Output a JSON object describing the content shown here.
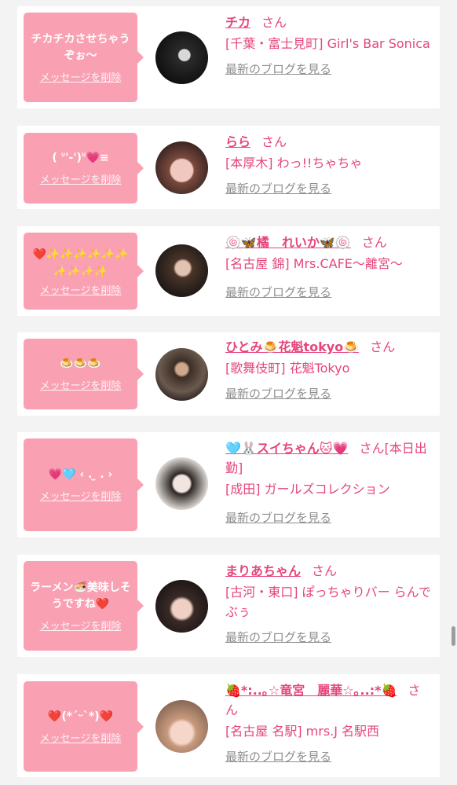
{
  "delete_label": "メッセージを削除",
  "san_label": "さん",
  "blog_label": "最新のブログを見る",
  "entries": [
    {
      "message": "チカチカさせちゃうぞぉ〜",
      "name": "チカ",
      "area_shop": "[千葉・富士見町] Girl's Bar Sonica"
    },
    {
      "message": "( ᐡ'-')ᐡ💗≡",
      "name": "らら",
      "area_shop": "[本厚木] わっ!!ちゃちゃ"
    },
    {
      "message": "❤️✨✨✨✨✨✨✨✨✨✨",
      "name": "🍥🦋橘　れいか🦋🍥",
      "area_shop": "[名古屋 錦] Mrs.CAFE〜離宮〜"
    },
    {
      "message": "🍮🍮🍮",
      "name": "ひとみ🍮花魁tokyo🍮",
      "area_shop": "[歌舞伎町] 花魁Tokyo"
    },
    {
      "message": "💗🩵 ‹ . ̫ .  ›",
      "name": "🩵🐰スイちゃん🐱💗",
      "name_suffix": "さん[本日出勤]",
      "area_shop": "[成田] ガールズコレクション"
    },
    {
      "message": "ラーメン🍜美味しそうですね❤️",
      "name": "まりあちゃん",
      "area_shop": "[古河・東口] ぽっちゃりバー らんでぶぅ"
    },
    {
      "message": "❤️(*´ᵕ`*)❤️",
      "name": "🍓*:..｡☆竜宮　麗華☆｡..:*🍓",
      "area_shop": "[名古屋 名駅] mrs.J 名駅西"
    }
  ],
  "colors": {
    "accent": "#e6457a",
    "bubble": "#f9a1b3",
    "muted": "#8e8e8e",
    "background": "#f3f3f3"
  }
}
